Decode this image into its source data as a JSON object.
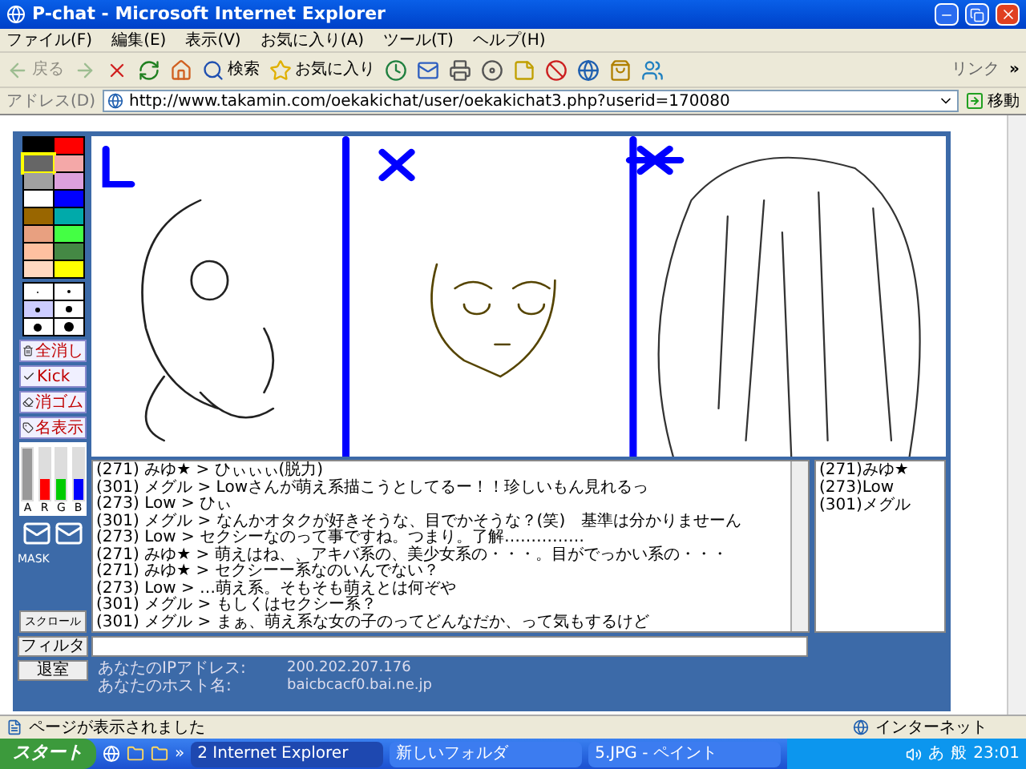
{
  "window": {
    "title": "P-chat - Microsoft Internet Explorer"
  },
  "menu": [
    "ファイル(F)",
    "編集(E)",
    "表示(V)",
    "お気に入り(A)",
    "ツール(T)",
    "ヘルプ(H)"
  ],
  "toolbar": [
    {
      "kind": "back",
      "label": "戻る",
      "disabled": true
    },
    {
      "kind": "forward",
      "disabled": true
    },
    {
      "kind": "stop",
      "disabled": false
    },
    {
      "kind": "refresh",
      "disabled": false
    },
    {
      "kind": "home",
      "disabled": false
    },
    {
      "kind": "search",
      "label": "検索",
      "disabled": false
    },
    {
      "kind": "favorites",
      "label": "お気に入り",
      "disabled": false
    },
    {
      "kind": "history",
      "disabled": false
    },
    {
      "kind": "mail",
      "disabled": false
    },
    {
      "kind": "print",
      "disabled": false
    },
    {
      "kind": "media",
      "disabled": false
    },
    {
      "kind": "note",
      "disabled": false
    },
    {
      "kind": "stopsign",
      "disabled": false
    },
    {
      "kind": "network",
      "disabled": false
    },
    {
      "kind": "bag",
      "disabled": false
    },
    {
      "kind": "messenger",
      "disabled": false
    }
  ],
  "links": {
    "label": "リンク",
    "more": "»"
  },
  "address": {
    "label": "アドレス(D)",
    "url": "http://www.takamin.com/oekakichat/user/oekakichat3.php?userid=170080",
    "go": "移動"
  },
  "palette": [
    {
      "color": "#000000",
      "selected": false
    },
    {
      "color": "#ff0000",
      "selected": false
    },
    {
      "color": "#666666",
      "selected": true
    },
    {
      "color": "#f4a8a8",
      "selected": false
    },
    {
      "color": "#a0a0a0",
      "selected": false
    },
    {
      "color": "#dda0dd",
      "selected": false
    },
    {
      "color": "#ffffff",
      "selected": false
    },
    {
      "color": "#0000ff",
      "selected": false
    },
    {
      "color": "#996600",
      "selected": false
    },
    {
      "color": "#00aaaa",
      "selected": false
    },
    {
      "color": "#e8a080",
      "selected": false
    },
    {
      "color": "#44ff44",
      "selected": false
    },
    {
      "color": "#ffc0a0",
      "selected": false
    },
    {
      "color": "#448844",
      "selected": false
    },
    {
      "color": "#ffd8c0",
      "selected": false
    },
    {
      "color": "#ffff00",
      "selected": false
    }
  ],
  "pen_sizes": [
    {
      "selected": false
    },
    {
      "selected": false
    },
    {
      "selected": true
    },
    {
      "selected": false
    },
    {
      "selected": false
    },
    {
      "selected": false
    }
  ],
  "tool_buttons": [
    {
      "kind": "clear",
      "label": "全消し"
    },
    {
      "kind": "kick",
      "label": "Kick"
    },
    {
      "kind": "eraser",
      "label": "消ゴム"
    },
    {
      "kind": "names",
      "label": "名表示"
    }
  ],
  "sliders": [
    {
      "label": "A",
      "color": "#999999",
      "level": 1
    },
    {
      "label": "R",
      "color": "#ff0000",
      "level": 0.4
    },
    {
      "label": "G",
      "color": "#00cc00",
      "level": 0.4
    },
    {
      "label": "B",
      "color": "#0000ff",
      "level": 0.4
    }
  ],
  "mask_label": "MASK",
  "scroll_button": "スクロール",
  "log": [
    "(271) みゆ★ > ひぃぃぃ(脱力)",
    "(301) メグル > Lowさんが萌え系描こうとしてるー！！珍しいもん見れるっ",
    "(273) Low > ひぃ",
    "(301) メグル > なんかオタクが好きそうな、目でかそうな？(笑)　基準は分かりませーん",
    "(273) Low > セクシーなのって事ですね。つまり。了解……………",
    "(271) みゆ★ > 萌えはね、、アキバ系の、美少女系の・・・。目がでっかい系の・・・",
    "(271) みゆ★ > セクシーー系なのいんでない？",
    "(273) Low > …萌え系。そもそも萌えとは何ぞや",
    "(301) メグル > もしくはセクシー系？",
    "(301) メグル > まぁ、萌え系な女の子のってどんなだか、って気もするけど"
  ],
  "users": [
    "(271)みゆ★",
    "(273)Low",
    "(301)メグル"
  ],
  "filter_button": "フィルタ",
  "exit_button": "退室",
  "info": [
    {
      "label": "あなたのIPアドレス:",
      "value": "200.202.207.176"
    },
    {
      "label": "あなたのホスト名:",
      "value": "baicbcacf0.bai.ne.jp"
    }
  ],
  "status": {
    "text": "ページが表示されました",
    "zone": "インターネット"
  },
  "taskbar": {
    "start": "スタート",
    "more": "»",
    "tasks": [
      {
        "label": "2 Internet Explorer",
        "selected": true
      },
      {
        "label": "新しいフォルダ",
        "selected": false
      },
      {
        "label": "5.JPG - ペイント",
        "selected": false
      }
    ],
    "ime": [
      "あ",
      "般"
    ],
    "time": "23:01"
  }
}
